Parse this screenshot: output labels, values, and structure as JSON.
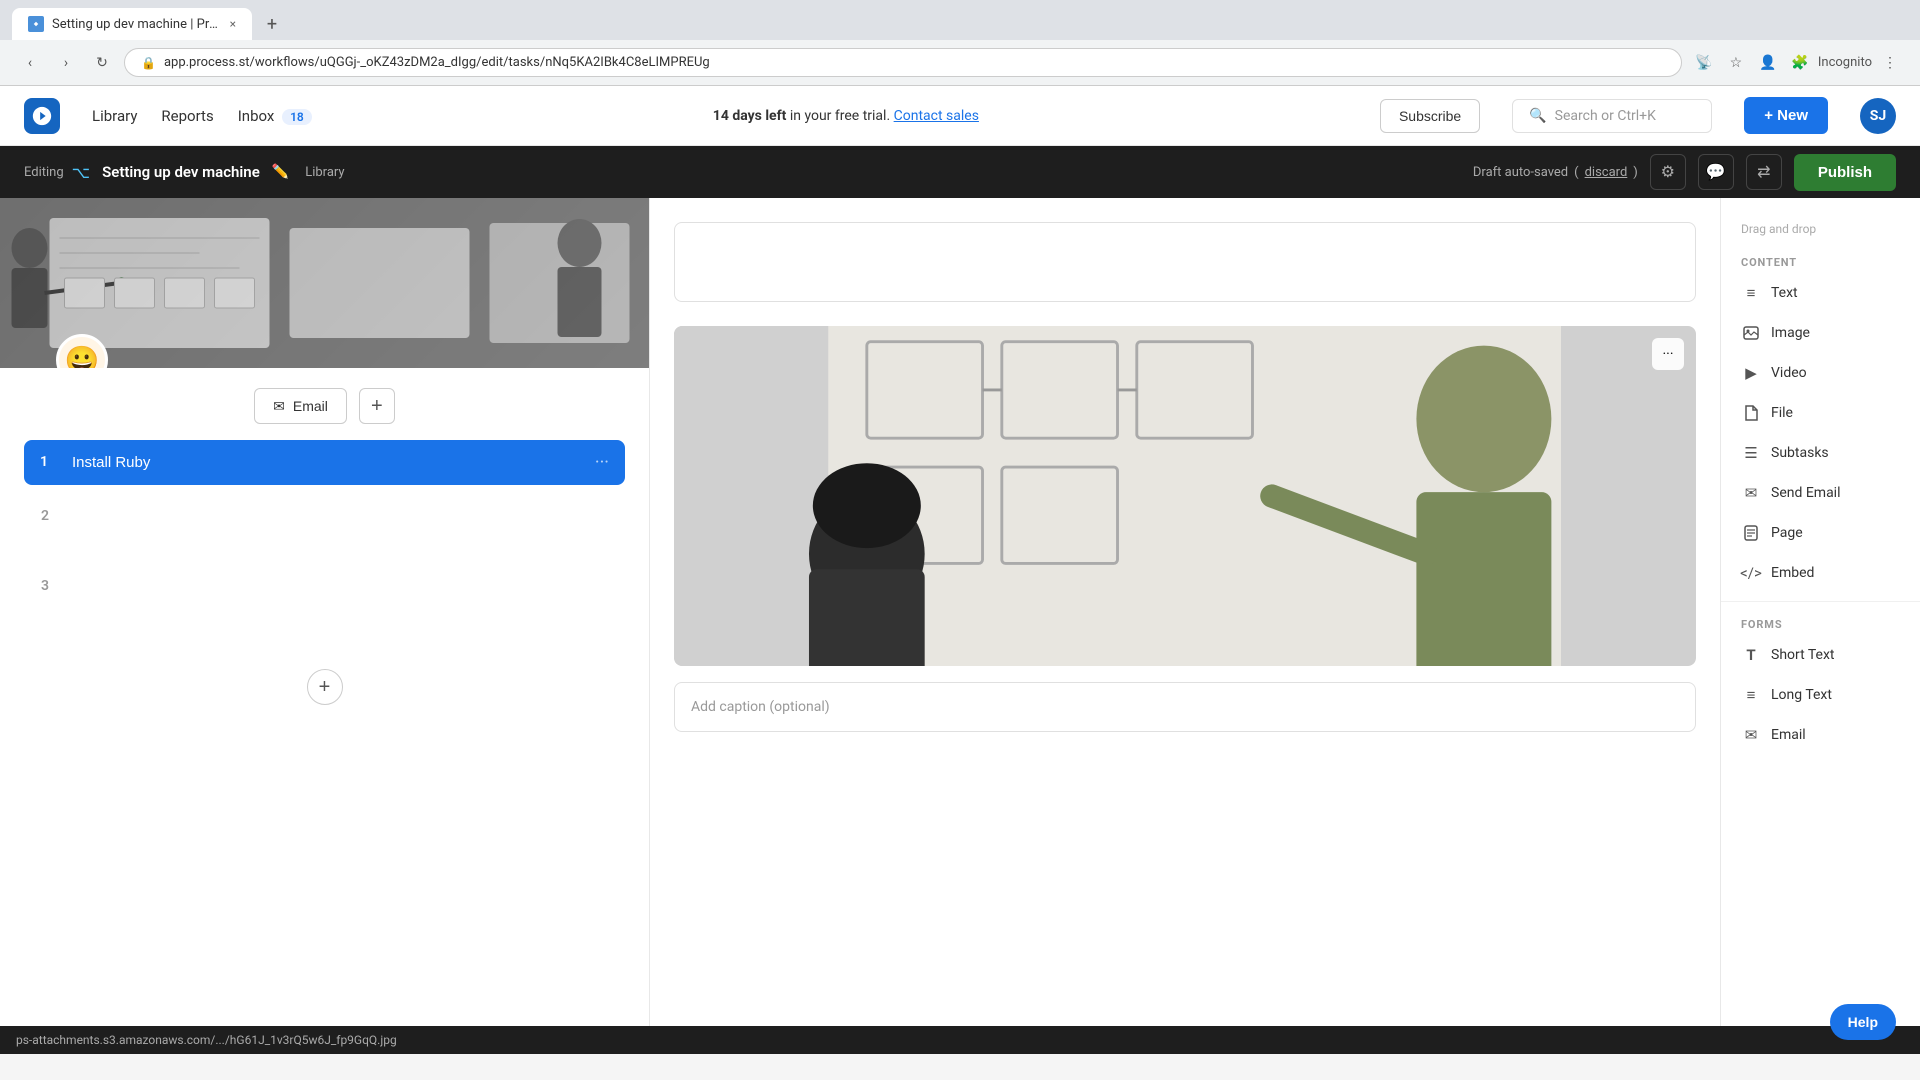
{
  "browser": {
    "tab_title": "Setting up dev machine | Process...",
    "tab_close": "×",
    "new_tab": "+",
    "address": "app.process.st/workflows/uQGGj-_oKZ43zDM2a_dIgg/edit/tasks/nNq5KA2IBk4C8eLIMPREUg",
    "nav_back": "‹",
    "nav_forward": "›",
    "nav_reload": "↻",
    "nav_incognito": "Incognito",
    "nav_more": "⋮"
  },
  "topnav": {
    "library": "Library",
    "reports": "Reports",
    "inbox": "Inbox",
    "inbox_count": "18",
    "trial_text1": "14 days left",
    "trial_text2": " in your free trial.",
    "contact_sales": "Contact sales",
    "subscribe": "Subscribe",
    "search_placeholder": "Search or Ctrl+K",
    "new_btn": "+ New",
    "avatar": "SJ"
  },
  "editor_header": {
    "editing": "Editing",
    "workflow_title": "Setting up dev machine",
    "library_link": "Library",
    "draft_status": "Draft auto-saved",
    "discard": "discard",
    "publish": "Publish"
  },
  "tasks": {
    "email_btn": "Email",
    "task1": {
      "number": "1",
      "title": "Install Ruby"
    },
    "task2": {
      "number": "2",
      "title": ""
    },
    "task3": {
      "number": "3",
      "title": ""
    },
    "add_task": "+"
  },
  "right_panel": {
    "caption_placeholder": "Add caption (optional)"
  },
  "sidebar": {
    "drag_drop": "Drag and drop",
    "content_header": "CONTENT",
    "items_content": [
      {
        "label": "Text",
        "icon": "≡"
      },
      {
        "label": "Image",
        "icon": "▭"
      },
      {
        "label": "Video",
        "icon": "▶"
      },
      {
        "label": "File",
        "icon": "📄"
      },
      {
        "label": "Subtasks",
        "icon": "☰"
      },
      {
        "label": "Send Email",
        "icon": "✉"
      },
      {
        "label": "Page",
        "icon": "📋"
      },
      {
        "label": "Embed",
        "icon": "<>"
      }
    ],
    "forms_header": "FORMS",
    "items_forms": [
      {
        "label": "Short Text",
        "icon": "T"
      },
      {
        "label": "Long Text",
        "icon": "≡"
      },
      {
        "label": "Email",
        "icon": "✉"
      }
    ]
  },
  "status_bar": {
    "url": "ps-attachments.s3.amazonaws.com/.../hG61J_1v3rQ5w6J_fp9GqQ.jpg"
  },
  "help_btn": "Help"
}
